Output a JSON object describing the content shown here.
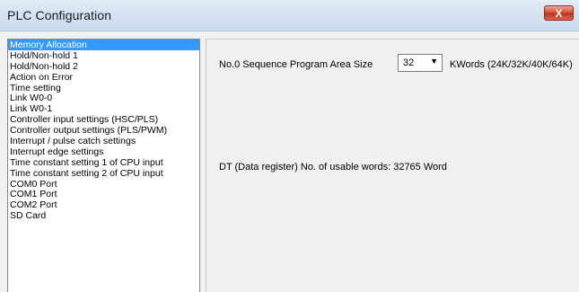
{
  "window": {
    "title": "PLC Configuration",
    "close_label": "X"
  },
  "list": {
    "items": [
      "Memory Allocation",
      "Hold/Non-hold 1",
      "Hold/Non-hold 2",
      "Action on Error",
      "Time setting",
      "Link W0-0",
      "Link W0-1",
      "Controller input settings (HSC/PLS)",
      "Controller output settings (PLS/PWM)",
      "Interrupt / pulse catch settings",
      "Interrupt edge settings",
      "Time constant setting 1 of CPU input",
      "Time constant setting 2 of CPU input",
      "COM0 Port",
      "COM1 Port",
      "COM2 Port",
      "SD Card"
    ],
    "selected": "Memory Allocation"
  },
  "content": {
    "sequence_label": "No.0 Sequence Program Area Size",
    "size_value": "32",
    "unit_label": "KWords  (24K/32K/40K/64K)",
    "dt_label": "DT (Data register) No. of usable words:  32765 Word"
  },
  "colors": {
    "selection": "#3399ff",
    "close_button": "#c9402a"
  },
  "icons": {
    "close": "close-icon",
    "dropdown": "chevron-down-icon"
  }
}
